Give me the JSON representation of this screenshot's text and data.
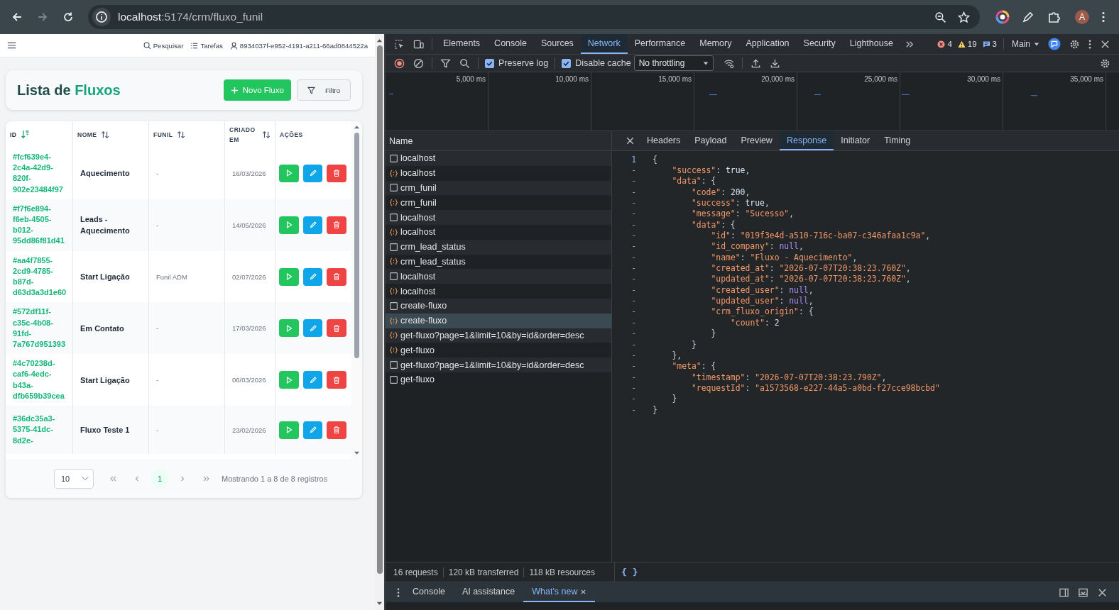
{
  "browser": {
    "url_host": "localhost",
    "url_rest": ":5174/crm/fluxo_funil",
    "forward_disabled": true,
    "avatar": "A"
  },
  "app_header": {
    "links": [
      {
        "kind": "search",
        "label": "Pesquisar"
      },
      {
        "kind": "tasks",
        "label": "Tarefas"
      },
      {
        "kind": "user",
        "label": "8934037f-e952-4191-a211-66ad0844522a"
      }
    ]
  },
  "page_title": {
    "lead": "Lista de",
    "accent": "Fluxos"
  },
  "actions": [
    {
      "kind": "primary",
      "label": "Novo Fluxo"
    },
    {
      "kind": "filter",
      "label": "Filtro"
    }
  ],
  "table": {
    "columns": [
      {
        "label": "ID",
        "sortable": true,
        "sorted": true
      },
      {
        "label": "NOME",
        "sortable": true,
        "sorted": false
      },
      {
        "label": "FUNIL",
        "sortable": true,
        "sorted": false
      },
      {
        "label": "CRIADO EM",
        "sortable": true,
        "sorted": false
      },
      {
        "label": "AÇÕES",
        "sortable": false,
        "sorted": false
      }
    ],
    "rows": [
      {
        "id": "#fcf639e4-2c4a-42d9-820f-902e23484f97",
        "name": "Aquecimento",
        "funil": "-",
        "created": "16/03/2026"
      },
      {
        "id": "#f7f6e894-f6eb-4505-b012-95dd86f81d41",
        "name": "Leads - Aquecimento",
        "funil": "-",
        "created": "14/05/2026"
      },
      {
        "id": "#aa4f7855-2cd9-4785-b87d-d63d3a3d1e60",
        "name": "Start Ligação",
        "funil": "Funil ADM",
        "created": "02/07/2026"
      },
      {
        "id": "#572df11f-c35c-4b08-91fd-7a767d951393",
        "name": "Em Contato",
        "funil": "-",
        "created": "17/03/2026"
      },
      {
        "id": "#4c70238d-caf6-4edc-b43a-dfb659b39cea",
        "name": "Start Ligação",
        "funil": "-",
        "created": "06/03/2026"
      },
      {
        "id": "#36dc35a3-5375-41dc-8d2e-",
        "name": "Fluxo Teste 1",
        "funil": "-",
        "created": "23/02/2026"
      }
    ]
  },
  "pagination": {
    "page_size": "10",
    "pages": [
      {
        "label": "1",
        "selected": true
      }
    ],
    "summary": "Mostrando 1 a 8 de 8 registros"
  },
  "devtools": {
    "tabs": [
      {
        "label": "Elements",
        "selected": false
      },
      {
        "label": "Console",
        "selected": false
      },
      {
        "label": "Sources",
        "selected": false
      },
      {
        "label": "Network",
        "selected": true
      },
      {
        "label": "Performance",
        "selected": false
      },
      {
        "label": "Memory",
        "selected": false
      },
      {
        "label": "Application",
        "selected": false
      },
      {
        "label": "Security",
        "selected": false
      },
      {
        "label": "Lighthouse",
        "selected": false
      }
    ],
    "errors": "4",
    "warnings": "19",
    "messages": "3",
    "context": "Main",
    "preserve_log": {
      "label": "Preserve log",
      "checked": true
    },
    "disable_cache": {
      "label": "Disable cache",
      "checked": true
    },
    "throttling": "No throttling",
    "timeline_ticks": [
      "5,000 ms",
      "10,000 ms",
      "15,000 ms",
      "20,000 ms",
      "25,000 ms",
      "30,000 ms",
      "35,000 ms"
    ],
    "name_header": "Name",
    "requests": [
      {
        "name": "localhost",
        "kind": "doc",
        "selected": false
      },
      {
        "name": "localhost",
        "kind": "fetch",
        "selected": false
      },
      {
        "name": "crm_funil",
        "kind": "doc",
        "selected": false
      },
      {
        "name": "crm_funil",
        "kind": "fetch",
        "selected": false
      },
      {
        "name": "localhost",
        "kind": "doc",
        "selected": false
      },
      {
        "name": "localhost",
        "kind": "fetch",
        "selected": false
      },
      {
        "name": "crm_lead_status",
        "kind": "doc",
        "selected": false
      },
      {
        "name": "crm_lead_status",
        "kind": "fetch",
        "selected": false
      },
      {
        "name": "localhost",
        "kind": "doc",
        "selected": false
      },
      {
        "name": "localhost",
        "kind": "fetch",
        "selected": false
      },
      {
        "name": "create-fluxo",
        "kind": "doc",
        "selected": false
      },
      {
        "name": "create-fluxo",
        "kind": "fetch",
        "selected": true
      },
      {
        "name": "get-fluxo?page=1&limit=10&by=id&order=desc",
        "kind": "fetch",
        "selected": false
      },
      {
        "name": "get-fluxo",
        "kind": "fetch",
        "selected": false
      },
      {
        "name": "get-fluxo?page=1&limit=10&by=id&order=desc",
        "kind": "doc",
        "selected": false
      },
      {
        "name": "get-fluxo",
        "kind": "doc",
        "selected": false
      }
    ],
    "detail_tabs": [
      {
        "label": "Headers",
        "selected": false
      },
      {
        "label": "Payload",
        "selected": false
      },
      {
        "label": "Preview",
        "selected": false
      },
      {
        "label": "Response",
        "selected": true
      },
      {
        "label": "Initiator",
        "selected": false
      },
      {
        "label": "Timing",
        "selected": false
      }
    ],
    "response": [
      {
        "gutter": "1",
        "tokens": [
          {
            "kind": "punct",
            "text": "{"
          }
        ],
        "children": [
          {
            "gutter": "-",
            "tokens": [
              {
                "kind": "key",
                "text": "\"success\""
              },
              {
                "kind": "punct",
                "text": ": "
              },
              {
                "kind": "literal",
                "text": "true"
              },
              {
                "kind": "punct",
                "text": ","
              }
            ]
          },
          {
            "gutter": "-",
            "tokens": [
              {
                "kind": "key",
                "text": "\"data\""
              },
              {
                "kind": "punct",
                "text": ": {"
              }
            ],
            "children": [
              {
                "gutter": "-",
                "tokens": [
                  {
                    "kind": "key",
                    "text": "\"code\""
                  },
                  {
                    "kind": "punct",
                    "text": ": "
                  },
                  {
                    "kind": "literal",
                    "text": "200"
                  },
                  {
                    "kind": "punct",
                    "text": ","
                  }
                ]
              },
              {
                "gutter": "-",
                "tokens": [
                  {
                    "kind": "key",
                    "text": "\"success\""
                  },
                  {
                    "kind": "punct",
                    "text": ": "
                  },
                  {
                    "kind": "literal",
                    "text": "true"
                  },
                  {
                    "kind": "punct",
                    "text": ","
                  }
                ]
              },
              {
                "gutter": "-",
                "tokens": [
                  {
                    "kind": "key",
                    "text": "\"message\""
                  },
                  {
                    "kind": "punct",
                    "text": ": "
                  },
                  {
                    "kind": "string",
                    "text": "\"Sucesso\""
                  },
                  {
                    "kind": "punct",
                    "text": ","
                  }
                ]
              },
              {
                "gutter": "-",
                "tokens": [
                  {
                    "kind": "key",
                    "text": "\"data\""
                  },
                  {
                    "kind": "punct",
                    "text": ": {"
                  }
                ],
                "children": [
                  {
                    "gutter": "-",
                    "tokens": [
                      {
                        "kind": "key",
                        "text": "\"id\""
                      },
                      {
                        "kind": "punct",
                        "text": ": "
                      },
                      {
                        "kind": "string",
                        "text": "\"019f3e4d-a510-716c-ba07-c346afaa1c9a\""
                      },
                      {
                        "kind": "punct",
                        "text": ","
                      }
                    ]
                  },
                  {
                    "gutter": "-",
                    "tokens": [
                      {
                        "kind": "key",
                        "text": "\"id_company\""
                      },
                      {
                        "kind": "punct",
                        "text": ": "
                      },
                      {
                        "kind": "null",
                        "text": "null"
                      },
                      {
                        "kind": "punct",
                        "text": ","
                      }
                    ]
                  },
                  {
                    "gutter": "-",
                    "tokens": [
                      {
                        "kind": "key",
                        "text": "\"name\""
                      },
                      {
                        "kind": "punct",
                        "text": ": "
                      },
                      {
                        "kind": "string",
                        "text": "\"Fluxo - Aquecimento\""
                      },
                      {
                        "kind": "punct",
                        "text": ","
                      }
                    ]
                  },
                  {
                    "gutter": "-",
                    "tokens": [
                      {
                        "kind": "key",
                        "text": "\"created_at\""
                      },
                      {
                        "kind": "punct",
                        "text": ": "
                      },
                      {
                        "kind": "string",
                        "text": "\"2026-07-07T20:38:23.760Z\""
                      },
                      {
                        "kind": "punct",
                        "text": ","
                      }
                    ]
                  },
                  {
                    "gutter": "-",
                    "tokens": [
                      {
                        "kind": "key",
                        "text": "\"updated_at\""
                      },
                      {
                        "kind": "punct",
                        "text": ": "
                      },
                      {
                        "kind": "string",
                        "text": "\"2026-07-07T20:38:23.760Z\""
                      },
                      {
                        "kind": "punct",
                        "text": ","
                      }
                    ]
                  },
                  {
                    "gutter": "-",
                    "tokens": [
                      {
                        "kind": "key",
                        "text": "\"created_user\""
                      },
                      {
                        "kind": "punct",
                        "text": ": "
                      },
                      {
                        "kind": "null",
                        "text": "null"
                      },
                      {
                        "kind": "punct",
                        "text": ","
                      }
                    ]
                  },
                  {
                    "gutter": "-",
                    "tokens": [
                      {
                        "kind": "key",
                        "text": "\"updated_user\""
                      },
                      {
                        "kind": "punct",
                        "text": ": "
                      },
                      {
                        "kind": "null",
                        "text": "null"
                      },
                      {
                        "kind": "punct",
                        "text": ","
                      }
                    ]
                  },
                  {
                    "gutter": "-",
                    "tokens": [
                      {
                        "kind": "key",
                        "text": "\"crm_fluxo_origin\""
                      },
                      {
                        "kind": "punct",
                        "text": ": {"
                      }
                    ],
                    "children": [
                      {
                        "gutter": "-",
                        "tokens": [
                          {
                            "kind": "key",
                            "text": "\"count\""
                          },
                          {
                            "kind": "punct",
                            "text": ": "
                          },
                          {
                            "kind": "literal",
                            "text": "2"
                          }
                        ]
                      }
                    ]
                  },
                  {
                    "gutter": "-",
                    "tokens": [
                      {
                        "kind": "punct",
                        "text": "}"
                      }
                    ]
                  }
                ]
              },
              {
                "gutter": "-",
                "tokens": [
                  {
                    "kind": "punct",
                    "text": "}"
                  }
                ]
              }
            ]
          },
          {
            "gutter": "-",
            "tokens": [
              {
                "kind": "punct",
                "text": "},"
              }
            ]
          },
          {
            "gutter": "-",
            "tokens": [
              {
                "kind": "key",
                "text": "\"meta\""
              },
              {
                "kind": "punct",
                "text": ": {"
              }
            ],
            "children": [
              {
                "gutter": "-",
                "tokens": [
                  {
                    "kind": "key",
                    "text": "\"timestamp\""
                  },
                  {
                    "kind": "punct",
                    "text": ": "
                  },
                  {
                    "kind": "string",
                    "text": "\"2026-07-07T20:38:23.790Z\""
                  },
                  {
                    "kind": "punct",
                    "text": ","
                  }
                ]
              },
              {
                "gutter": "-",
                "tokens": [
                  {
                    "kind": "key",
                    "text": "\"requestId\""
                  },
                  {
                    "kind": "punct",
                    "text": ": "
                  },
                  {
                    "kind": "string",
                    "text": "\"a1573568-e227-44a5-a0bd-f27cce98bcbd\""
                  }
                ]
              }
            ]
          },
          {
            "gutter": "-",
            "tokens": [
              {
                "kind": "punct",
                "text": "}"
              }
            ]
          }
        ]
      },
      {
        "gutter": "-",
        "tokens": [
          {
            "kind": "punct",
            "text": "}"
          }
        ]
      }
    ],
    "status": [
      "16 requests",
      "120 kB transferred",
      "118 kB resources"
    ],
    "format_button": "{ }",
    "drawer_tabs": [
      {
        "label": "Console",
        "selected": false,
        "closable": false
      },
      {
        "label": "AI assistance",
        "selected": false,
        "closable": false
      },
      {
        "label": "What's new",
        "selected": true,
        "closable": true
      }
    ]
  }
}
